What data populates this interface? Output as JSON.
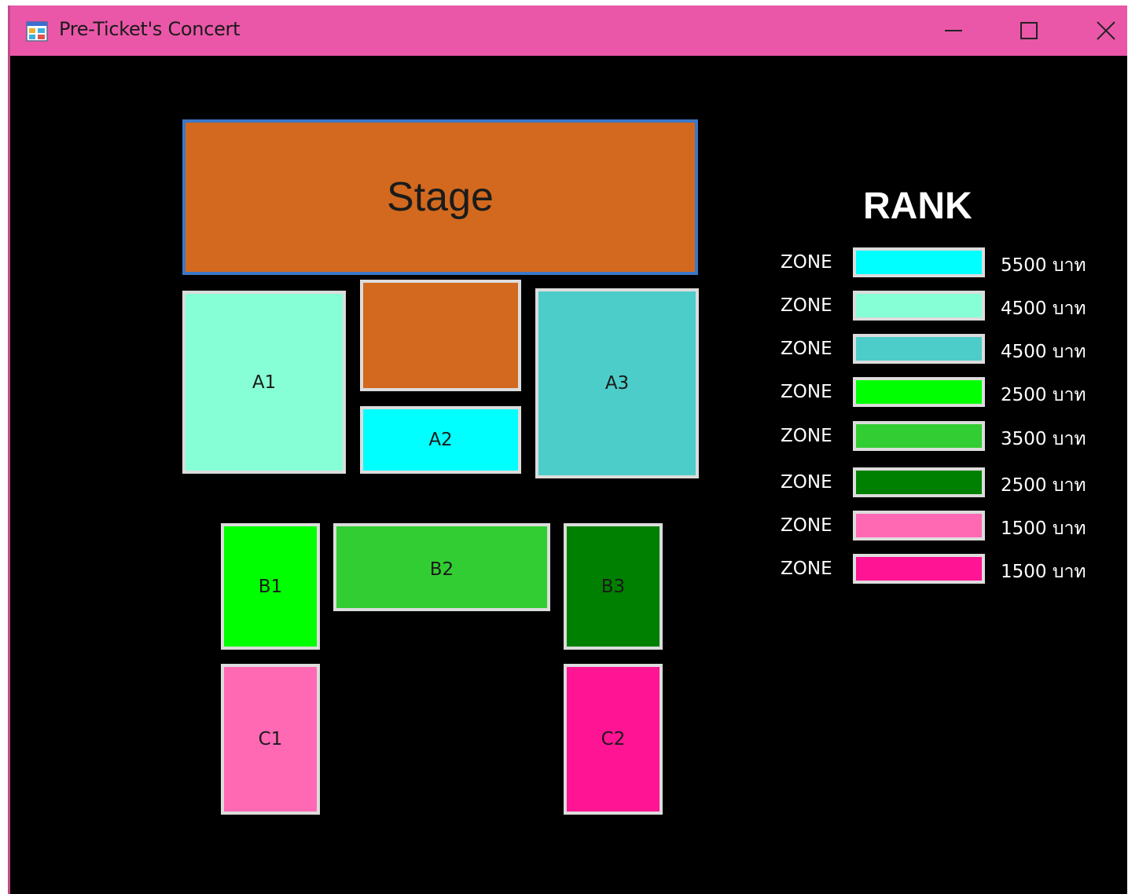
{
  "window": {
    "title": "Pre-Ticket's Concert"
  },
  "seating": {
    "stage_label": "Stage",
    "zones": {
      "A1": {
        "label": "A1",
        "color": "#87ffd6"
      },
      "A2": {
        "label": "A2",
        "color": "#00ffff"
      },
      "A2_upper": {
        "label": "",
        "color": "#d2691e"
      },
      "A3": {
        "label": "A3",
        "color": "#4dcdc9"
      },
      "B1": {
        "label": "B1",
        "color": "#00ff00"
      },
      "B2": {
        "label": "B2",
        "color": "#32cd32"
      },
      "B3": {
        "label": "B3",
        "color": "#008000"
      },
      "C1": {
        "label": "C1",
        "color": "#ff69b4"
      },
      "C2": {
        "label": "C2",
        "color": "#ff1493"
      }
    },
    "stage_color": "#d2691e",
    "stage_border": "#3a78c8"
  },
  "legend": {
    "title": "RANK",
    "rows": [
      {
        "label": "ZONE",
        "color": "#00ffff",
        "price": "5500 บาท"
      },
      {
        "label": "ZONE",
        "color": "#87ffd6",
        "price": "4500 บาท"
      },
      {
        "label": "ZONE",
        "color": "#4dcdc9",
        "price": "4500 บาท"
      },
      {
        "label": "ZONE",
        "color": "#00ff00",
        "price": "2500 บาท"
      },
      {
        "label": "ZONE",
        "color": "#32cd32",
        "price": "3500 บาท"
      },
      {
        "label": "ZONE",
        "color": "#008000",
        "price": "2500 บาท"
      },
      {
        "label": "ZONE",
        "color": "#ff69b4",
        "price": "1500 บาท"
      },
      {
        "label": "ZONE",
        "color": "#ff1493",
        "price": "1500 บาท"
      }
    ]
  },
  "icons": {
    "app": "app-window-icon",
    "minimize": "minimize-icon",
    "maximize": "maximize-icon",
    "close": "close-icon"
  },
  "theme": {
    "titlebar": "#ea57a8",
    "background": "#000000",
    "zone_border": "#dcdcdc"
  }
}
